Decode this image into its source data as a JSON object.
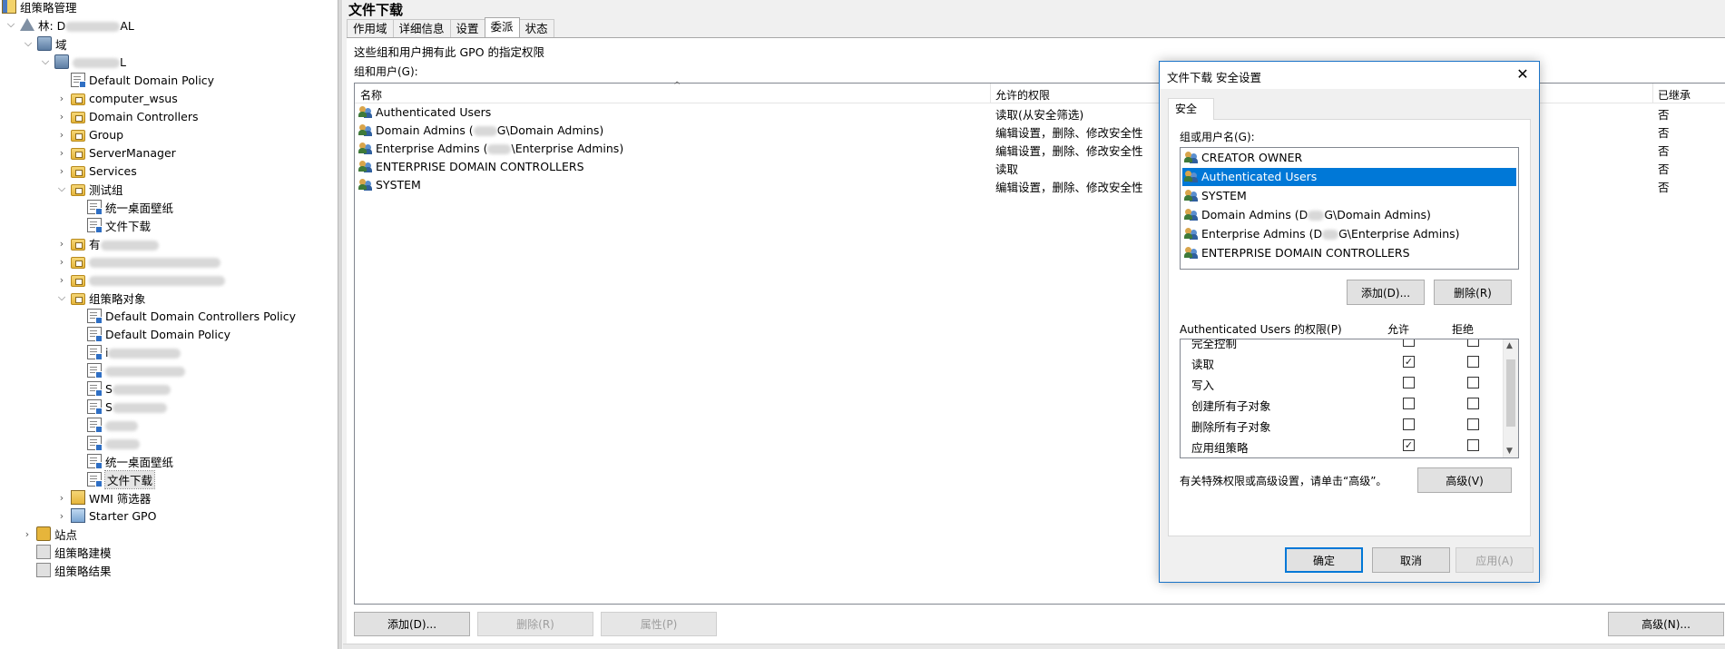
{
  "tree": {
    "root": "组策略管理",
    "forest": "林: D",
    "forest_tail": "AL",
    "domains": "域",
    "domain_tail": "L",
    "items": [
      {
        "label": "Default Domain Policy"
      },
      {
        "label": "computer_wsus"
      },
      {
        "label": "Domain Controllers"
      },
      {
        "label": "Group"
      },
      {
        "label": "ServerManager"
      },
      {
        "label": "Services"
      },
      {
        "label": "测试组"
      },
      {
        "label": "统一桌面壁纸"
      },
      {
        "label": "文件下载"
      },
      {
        "label": "有"
      },
      {
        "label": "组策略对象"
      },
      {
        "label": "Default Domain Controllers Policy"
      },
      {
        "label": "Default Domain Policy"
      },
      {
        "label": "i"
      },
      {
        "label": "S"
      },
      {
        "label": "S"
      },
      {
        "label": "统一桌面壁纸"
      },
      {
        "label": "文件下载"
      },
      {
        "label": "WMI 筛选器"
      },
      {
        "label": "Starter GPO"
      },
      {
        "label": "站点"
      },
      {
        "label": "组策略建模"
      },
      {
        "label": "组策略结果"
      }
    ]
  },
  "gpo": {
    "title": "文件下载",
    "tabs": [
      "作用域",
      "详细信息",
      "设置",
      "委派",
      "状态"
    ],
    "active_tab": "委派",
    "description": "这些组和用户拥有此 GPO 的指定权限",
    "groups_label": "组和用户(G):",
    "columns": [
      "名称",
      "允许的权限",
      "已继承"
    ],
    "rows": [
      {
        "name": "Authenticated Users",
        "perm": "读取(从安全筛选)",
        "inherited": "否"
      },
      {
        "name_pre": "Domain Admins (",
        "name_post": "G\\Domain Admins)",
        "perm": "编辑设置，删除、修改安全性",
        "inherited": "否"
      },
      {
        "name_pre": "Enterprise Admins (",
        "name_post": "\\Enterprise Admins)",
        "perm": "编辑设置，删除、修改安全性",
        "inherited": "否"
      },
      {
        "name": "ENTERPRISE DOMAIN CONTROLLERS",
        "perm": "读取",
        "inherited": "否"
      },
      {
        "name": "SYSTEM",
        "perm": "编辑设置，删除、修改安全性",
        "inherited": "否"
      }
    ],
    "buttons": {
      "add": "添加(D)...",
      "remove": "删除(R)",
      "properties": "属性(P)",
      "advanced": "高级(N)..."
    }
  },
  "dialog": {
    "title": "文件下载 安全设置",
    "tab": "安全",
    "groups_label": "组或用户名(G):",
    "users": [
      {
        "name": "CREATOR OWNER"
      },
      {
        "name": "Authenticated Users",
        "selected": true
      },
      {
        "name": "SYSTEM"
      },
      {
        "name_pre": "Domain Admins (D",
        "name_post": "G\\Domain Admins)"
      },
      {
        "name_pre": "Enterprise Admins (D",
        "name_post": "G\\Enterprise Admins)"
      },
      {
        "name": "ENTERPRISE DOMAIN CONTROLLERS"
      }
    ],
    "add_button": "添加(D)...",
    "remove_button": "删除(R)",
    "perm_label": "Authenticated Users 的权限(P)",
    "allow_header": "允许",
    "deny_header": "拒绝",
    "permissions": [
      {
        "name": "完全控制",
        "allow": false,
        "deny": false
      },
      {
        "name": "读取",
        "allow": true,
        "deny": false
      },
      {
        "name": "写入",
        "allow": false,
        "deny": false
      },
      {
        "name": "创建所有子对象",
        "allow": false,
        "deny": false
      },
      {
        "name": "删除所有子对象",
        "allow": false,
        "deny": false
      },
      {
        "name": "应用组策略",
        "allow": true,
        "deny": false
      }
    ],
    "note": "有关特殊权限或高级设置，请单击“高级”。",
    "advanced_button": "高级(V)",
    "ok": "确定",
    "cancel": "取消",
    "apply": "应用(A)"
  },
  "colors": {
    "accent": "#0078d7",
    "selection": "#0078d7"
  }
}
